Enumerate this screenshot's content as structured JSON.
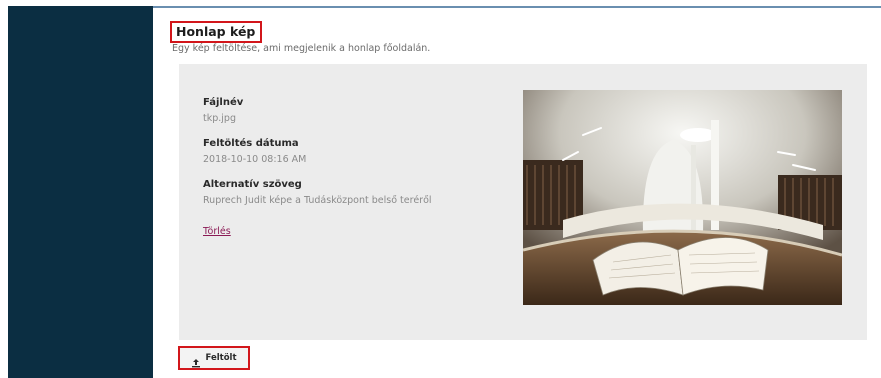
{
  "section": {
    "title": "Honlap kép",
    "description": "Egy kép feltöltése, ami megjelenik a honlap főoldalán."
  },
  "file": {
    "filename_label": "Fájlnév",
    "filename_value": "tkp.jpg",
    "upload_date_label": "Feltöltés dátuma",
    "upload_date_value": "2018-10-10 08:16 AM",
    "alt_text_label": "Alternatív szöveg",
    "alt_text_value": "Ruprech Judit képe a Tudásközpont belső teréről",
    "delete_label": "Törlés"
  },
  "actions": {
    "upload_label": "Feltölt",
    "upload_icon": "upload-icon"
  },
  "colors": {
    "sidebar": "#0b2e42",
    "highlight_border": "#d2161b",
    "link": "#8b1a55",
    "panel": "#ececec"
  }
}
